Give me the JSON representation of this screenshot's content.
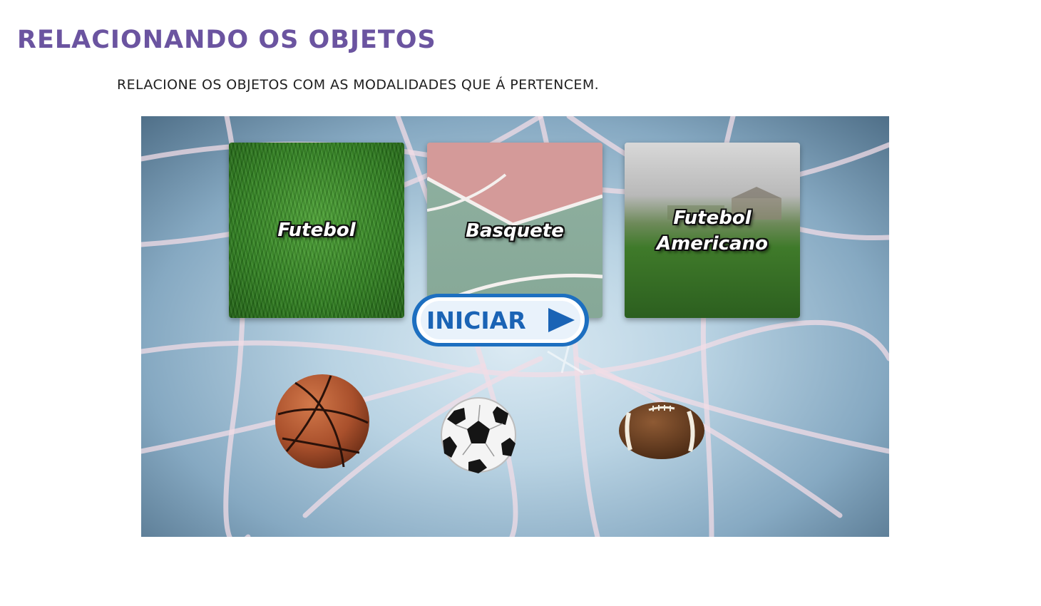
{
  "header": {
    "title": "RELACIONANDO OS OBJETOS",
    "instruction": "RELACIONE OS OBJETOS COM AS MODALIDADES QUE Á PERTENCEM."
  },
  "game": {
    "cards": [
      {
        "label": "Futebol"
      },
      {
        "label": "Basquete"
      },
      {
        "label_line1": "Futebol",
        "label_line2": "Americano"
      }
    ],
    "start_button": {
      "label": "INICIAR"
    },
    "balls": [
      "basketball-icon",
      "soccer-ball-icon",
      "football-icon"
    ]
  },
  "colors": {
    "title": "#6b54a0",
    "button_blue": "#1d6fc0",
    "button_text": "#1a63b5"
  }
}
